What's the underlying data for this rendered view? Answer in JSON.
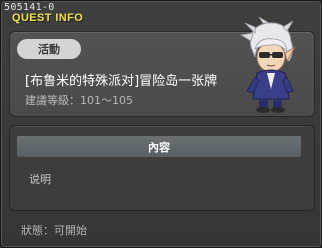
{
  "window": {
    "quest_id": "505141-0",
    "title": "QUEST INFO"
  },
  "quest": {
    "category_badge": "活動",
    "name": "[布鲁米的特殊派对]冒险岛一张牌",
    "level_requirement": "建議等級：101～105"
  },
  "content": {
    "section_header": "內容",
    "description_label": "说明"
  },
  "footer": {
    "status": "狀態：可開始"
  },
  "colors": {
    "title": "#f0e24c",
    "badge_bg": "#d4d4d4",
    "header_bg": "#62696c"
  },
  "icons": {
    "npc": "npc-character-portrait"
  }
}
